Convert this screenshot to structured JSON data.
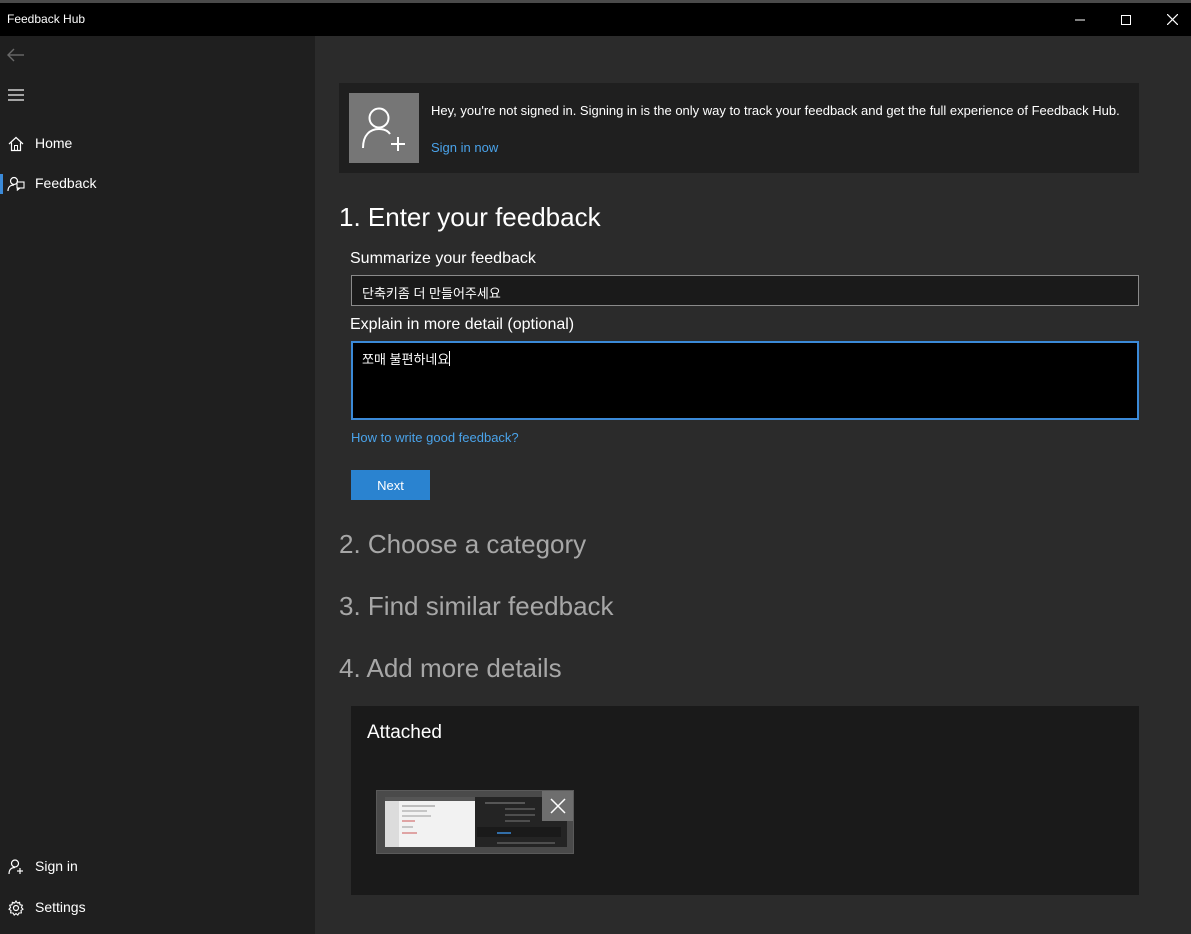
{
  "window": {
    "title": "Feedback Hub"
  },
  "sidebar": {
    "items": [
      {
        "label": "Home",
        "icon": "home-icon"
      },
      {
        "label": "Feedback",
        "icon": "feedback-icon",
        "selected": true
      }
    ],
    "footer": [
      {
        "label": "Sign in",
        "icon": "person-add-icon"
      },
      {
        "label": "Settings",
        "icon": "gear-icon"
      }
    ]
  },
  "banner": {
    "message": "Hey, you're not signed in. Signing in is the only way to track your feedback and get the full experience of Feedback Hub.",
    "link": "Sign in now"
  },
  "form": {
    "step1": "1. Enter your feedback",
    "summary_label": "Summarize your feedback",
    "summary_value": "단축키좀 더 만들어주세요",
    "detail_label": "Explain in more detail (optional)",
    "detail_value": "쪼매 불편하네요",
    "help_link": "How to write good feedback?",
    "next_label": "Next",
    "step2": "2. Choose a category",
    "step3": "3. Find similar feedback",
    "step4": "4. Add more details"
  },
  "attached": {
    "heading": "Attached"
  },
  "colors": {
    "accent": "#2a83d0",
    "link": "#4aa3ea",
    "sidebar_bg": "#1f1f1f",
    "main_bg": "#2b2b2b"
  }
}
